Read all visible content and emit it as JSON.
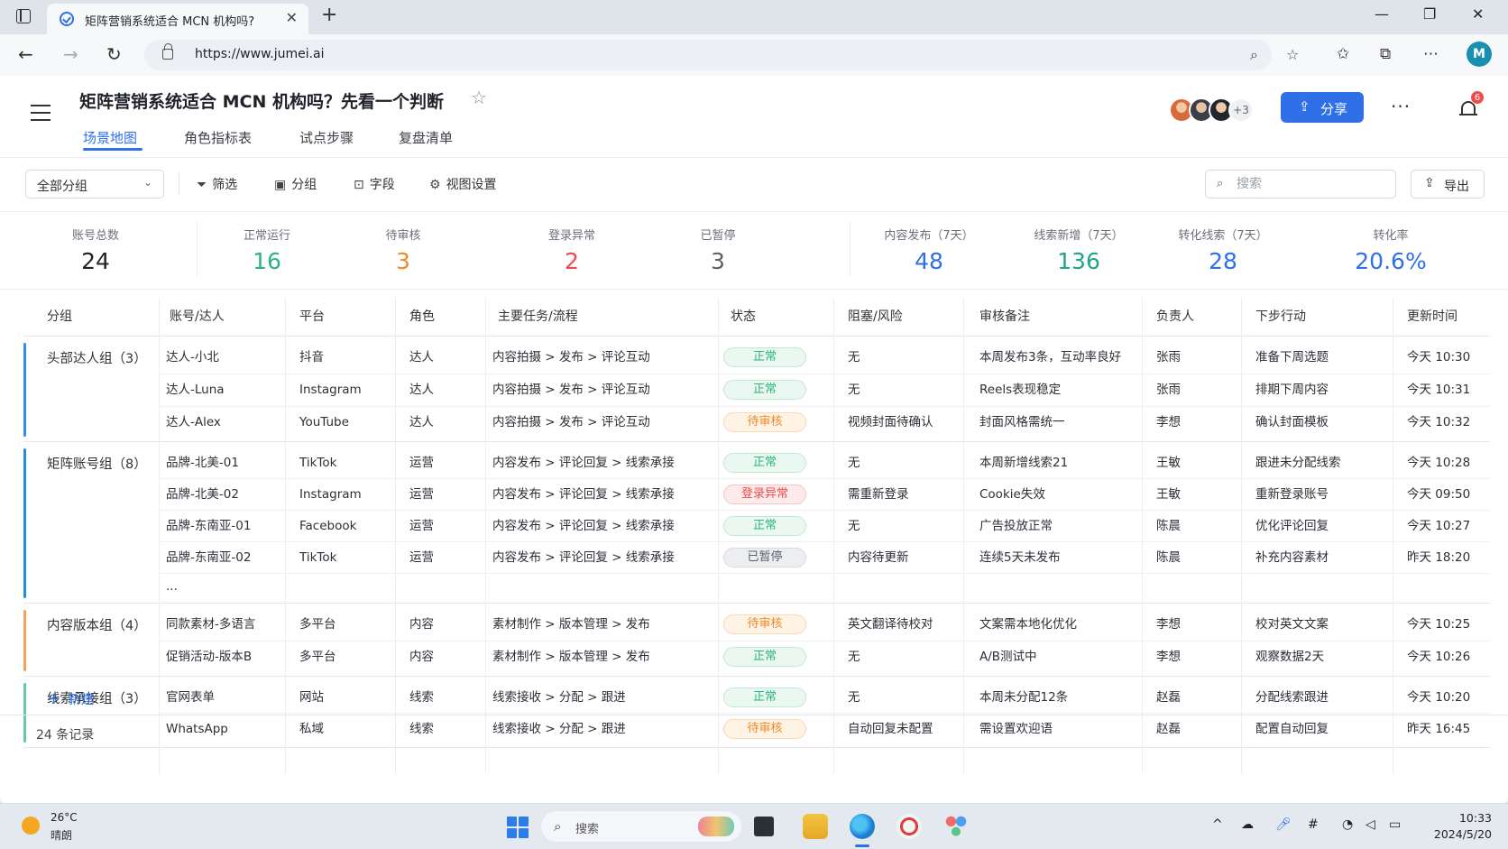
{
  "browser": {
    "tab_title": "矩阵营销系统适合 MCN 机构吗?",
    "url": "https://www.jumei.ai",
    "profile_initial": "M"
  },
  "app": {
    "title": "矩阵营销系统适合 MCN 机构吗？先看一个判断",
    "tabs": [
      "场景地图",
      "角色指标表",
      "试点步骤",
      "复盘清单"
    ],
    "collaborators_more": "+3",
    "share_label": "分享",
    "notification_count": "6"
  },
  "toolbar": {
    "group_select": "全部分组",
    "filter": "筛选",
    "group": "分组",
    "fields": "字段",
    "view_settings": "视图设置",
    "search_placeholder": "搜索",
    "export": "导出"
  },
  "stats": [
    {
      "label": "账号总数",
      "value": "24",
      "color": "#1f2329"
    },
    {
      "label": "正常运行",
      "value": "16",
      "color": "#2bb380"
    },
    {
      "label": "待审核",
      "value": "3",
      "color": "#f08a24"
    },
    {
      "label": "登录异常",
      "value": "2",
      "color": "#f04b4b"
    },
    {
      "label": "已暂停",
      "value": "3",
      "color": "#5b6068"
    },
    {
      "label": "内容发布（7天）",
      "value": "48",
      "color": "#2f6fe8"
    },
    {
      "label": "线索新增（7天）",
      "value": "136",
      "color": "#1fa588"
    },
    {
      "label": "转化线索（7天）",
      "value": "28",
      "color": "#2f6fe8"
    },
    {
      "label": "转化率",
      "value": "20.6%",
      "color": "#2f6fe8"
    }
  ],
  "columns": [
    "分组",
    "账号/达人",
    "平台",
    "角色",
    "主要任务/流程",
    "状态",
    "阻塞/风险",
    "审核备注",
    "负责人",
    "下步行动",
    "更新时间"
  ],
  "status_styles": {
    "正常": {
      "fg": "#2bb380",
      "bg": "#eaf8f1",
      "border": "#bfe9d5"
    },
    "待审核": {
      "fg": "#f08a24",
      "bg": "#fff3e6",
      "border": "#fbd9b3"
    },
    "登录异常": {
      "fg": "#f04b4b",
      "bg": "#fdeaea",
      "border": "#f7c4c4"
    },
    "已暂停": {
      "fg": "#5b6068",
      "bg": "#eceef1",
      "border": "#d8dbe0"
    }
  },
  "groups": [
    {
      "label": "头部达人组（3）",
      "color": "#2f8fe8",
      "rows": [
        {
          "account": "达人-小北",
          "platform": "抖音",
          "role": "达人",
          "task": "内容拍摄 > 发布 > 评论互动",
          "status": "正常",
          "risk": "无",
          "note": "本周发布3条，互动率良好",
          "owner": "张雨",
          "next": "准备下周选题",
          "time": "今天 10:30"
        },
        {
          "account": "达人-Luna",
          "platform": "Instagram",
          "role": "达人",
          "task": "内容拍摄 > 发布 > 评论互动",
          "status": "正常",
          "risk": "无",
          "note": "Reels表现稳定",
          "owner": "张雨",
          "next": "排期下周内容",
          "time": "今天 10:31"
        },
        {
          "account": "达人-Alex",
          "platform": "YouTube",
          "role": "达人",
          "task": "内容拍摄 > 发布 > 评论互动",
          "status": "待审核",
          "risk": "视频封面待确认",
          "note": "封面风格需统一",
          "owner": "李想",
          "next": "确认封面模板",
          "time": "今天 10:32"
        }
      ]
    },
    {
      "label": "矩阵账号组（8）",
      "color": "#1f8fd8",
      "rows": [
        {
          "account": "品牌-北美-01",
          "platform": "TikTok",
          "role": "运营",
          "task": "内容发布 > 评论回复 > 线索承接",
          "status": "正常",
          "risk": "无",
          "note": "本周新增线索21",
          "owner": "王敏",
          "next": "跟进未分配线索",
          "time": "今天 10:28"
        },
        {
          "account": "品牌-北美-02",
          "platform": "Instagram",
          "role": "运营",
          "task": "内容发布 > 评论回复 > 线索承接",
          "status": "登录异常",
          "risk": "需重新登录",
          "note": "Cookie失效",
          "owner": "王敏",
          "next": "重新登录账号",
          "time": "今天 09:50"
        },
        {
          "account": "品牌-东南亚-01",
          "platform": "Facebook",
          "role": "运营",
          "task": "内容发布 > 评论回复 > 线索承接",
          "status": "正常",
          "risk": "无",
          "note": "广告投放正常",
          "owner": "陈晨",
          "next": "优化评论回复",
          "time": "今天 10:27"
        },
        {
          "account": "品牌-东南亚-02",
          "platform": "TikTok",
          "role": "运营",
          "task": "内容发布 > 评论回复 > 线索承接",
          "status": "已暂停",
          "risk": "内容待更新",
          "note": "连续5天未发布",
          "owner": "陈晨",
          "next": "补充内容素材",
          "time": "昨天 18:20"
        },
        {
          "account": "...",
          "platform": "",
          "role": "",
          "task": "",
          "status": "",
          "risk": "",
          "note": "",
          "owner": "",
          "next": "",
          "time": ""
        }
      ]
    },
    {
      "label": "内容版本组（4）",
      "color": "#f5a35c",
      "rows": [
        {
          "account": "同款素材-多语言",
          "platform": "多平台",
          "role": "内容",
          "task": "素材制作 > 版本管理 > 发布",
          "status": "待审核",
          "risk": "英文翻译待校对",
          "note": "文案需本地化优化",
          "owner": "李想",
          "next": "校对英文文案",
          "time": "今天 10:25"
        },
        {
          "account": "促销活动-版本B",
          "platform": "多平台",
          "role": "内容",
          "task": "素材制作 > 版本管理 > 发布",
          "status": "正常",
          "risk": "无",
          "note": "A/B测试中",
          "owner": "李想",
          "next": "观察数据2天",
          "time": "今天 10:26"
        }
      ]
    },
    {
      "label": "线索承接组（3）",
      "color": "#6cc9a4",
      "rows": [
        {
          "account": "官网表单",
          "platform": "网站",
          "role": "线索",
          "task": "线索接收 > 分配 > 跟进",
          "status": "正常",
          "risk": "无",
          "note": "本周未分配12条",
          "owner": "赵磊",
          "next": "分配线索跟进",
          "time": "今天 10:20"
        },
        {
          "account": "WhatsApp",
          "platform": "私域",
          "role": "线索",
          "task": "线索接收 > 分配 > 跟进",
          "status": "待审核",
          "risk": "自动回复未配置",
          "note": "需设置欢迎语",
          "owner": "赵磊",
          "next": "配置自动回复",
          "time": "昨天 16:45"
        }
      ]
    }
  ],
  "table_footer": {
    "new_label": "新建",
    "record_count": "24 条记录"
  },
  "taskbar": {
    "temperature": "26°C",
    "weather": "晴朗",
    "search_label": "搜索",
    "time": "10:33",
    "date": "2024/5/20"
  }
}
